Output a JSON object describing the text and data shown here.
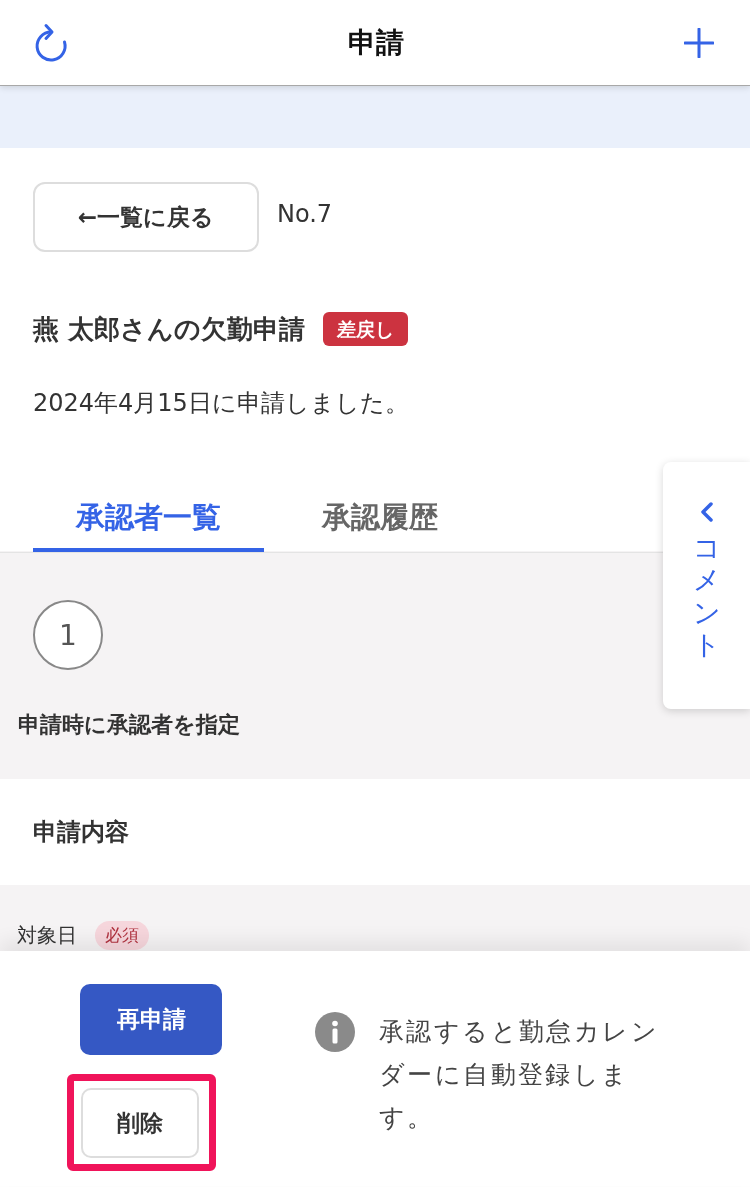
{
  "header": {
    "title": "申請"
  },
  "request": {
    "back_label": "←一覧に戻る",
    "number": "No.7",
    "title": "燕 太郎さんの欠勤申請",
    "status": "差戻し",
    "submitted": "2024年4月15日に申請しました。"
  },
  "tabs": [
    {
      "label": "承認者一覧",
      "selected": true
    },
    {
      "label": "承認履歴",
      "selected": false
    }
  ],
  "approval_steps": [
    {
      "number": "1",
      "description": "申請時に承認者を指定"
    }
  ],
  "content_section": {
    "title": "申請内容",
    "fields": [
      {
        "label": "対象日",
        "required": true,
        "badge": "必須"
      }
    ]
  },
  "footer": {
    "buttons": [
      {
        "label": "再申請",
        "kind": "primary",
        "highlighted": false
      },
      {
        "label": "削除",
        "kind": "secondary",
        "highlighted": true
      }
    ],
    "note": "承認すると勤怠カレンダーに自動登録します。"
  },
  "comment_tab": {
    "label": "コメント"
  }
}
